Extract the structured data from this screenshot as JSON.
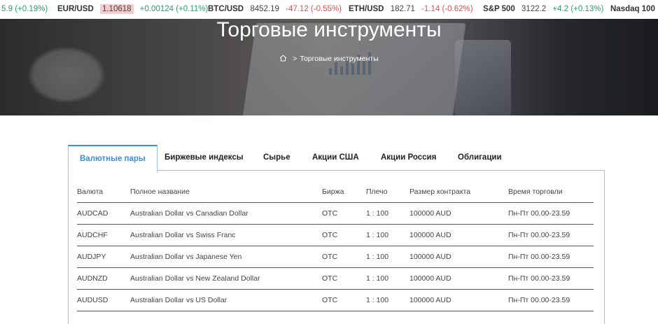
{
  "ticker": [
    {
      "symbol": "",
      "price": "5.9",
      "change": "(+0.19%)",
      "dir": "up"
    },
    {
      "symbol": "EUR/USD",
      "price": "1.10618",
      "change": "+0.00124 (+0.11%)",
      "dir": "up",
      "highlight": true
    },
    {
      "symbol": "BTC/USD",
      "price": "8452.19",
      "change": "-47.12 (-0.55%)",
      "dir": "down"
    },
    {
      "symbol": "ETH/USD",
      "price": "182.71",
      "change": "-1.14 (-0.62%)",
      "dir": "down"
    },
    {
      "symbol": "S&P 500",
      "price": "3122.2",
      "change": "+4.2 (+0.13%)",
      "dir": "up"
    },
    {
      "symbol": "Nasdaq 100",
      "price": "",
      "change": "",
      "dir": "up"
    }
  ],
  "hero": {
    "title": "Торговые инструменты",
    "breadcrumb_sep": ">",
    "breadcrumb_current": "Торговые инструменты"
  },
  "tabs": [
    {
      "label": "Валютные пары",
      "active": true
    },
    {
      "label": "Биржевые индексы"
    },
    {
      "label": "Сырье"
    },
    {
      "label": "Акции США"
    },
    {
      "label": "Акции Россия"
    },
    {
      "label": "Облигации"
    }
  ],
  "table": {
    "headers": [
      "Валюта",
      "Полное название",
      "Биржа",
      "Плечо",
      "Размер контракта",
      "Время торговли"
    ],
    "rows": [
      [
        "AUDCAD",
        "Australian Dollar vs Canadian Dollar",
        "OTC",
        "1 : 100",
        "100000 AUD",
        "Пн-Пт 00.00-23.59"
      ],
      [
        "AUDCHF",
        "Australian Dollar vs Swiss Franc",
        "OTC",
        "1 : 100",
        "100000 AUD",
        "Пн-Пт 00.00-23.59"
      ],
      [
        "AUDJPY",
        "Australian Dollar vs Japanese Yen",
        "OTC",
        "1 : 100",
        "100000 AUD",
        "Пн-Пт 00.00-23.59"
      ],
      [
        "AUDNZD",
        "Australian Dollar vs New Zealand Dollar",
        "OTC",
        "1 : 100",
        "100000 AUD",
        "Пн-Пт 00.00-23.59"
      ],
      [
        "AUDUSD",
        "Australian Dollar vs US Dollar",
        "OTC",
        "1 : 100",
        "100000 AUD",
        "Пн-Пт 00.00-23.59"
      ]
    ]
  },
  "colors": {
    "accent": "#3d8fd1",
    "up": "#2e9b6b",
    "down": "#d9534f",
    "highlight": "#f4cccc"
  }
}
